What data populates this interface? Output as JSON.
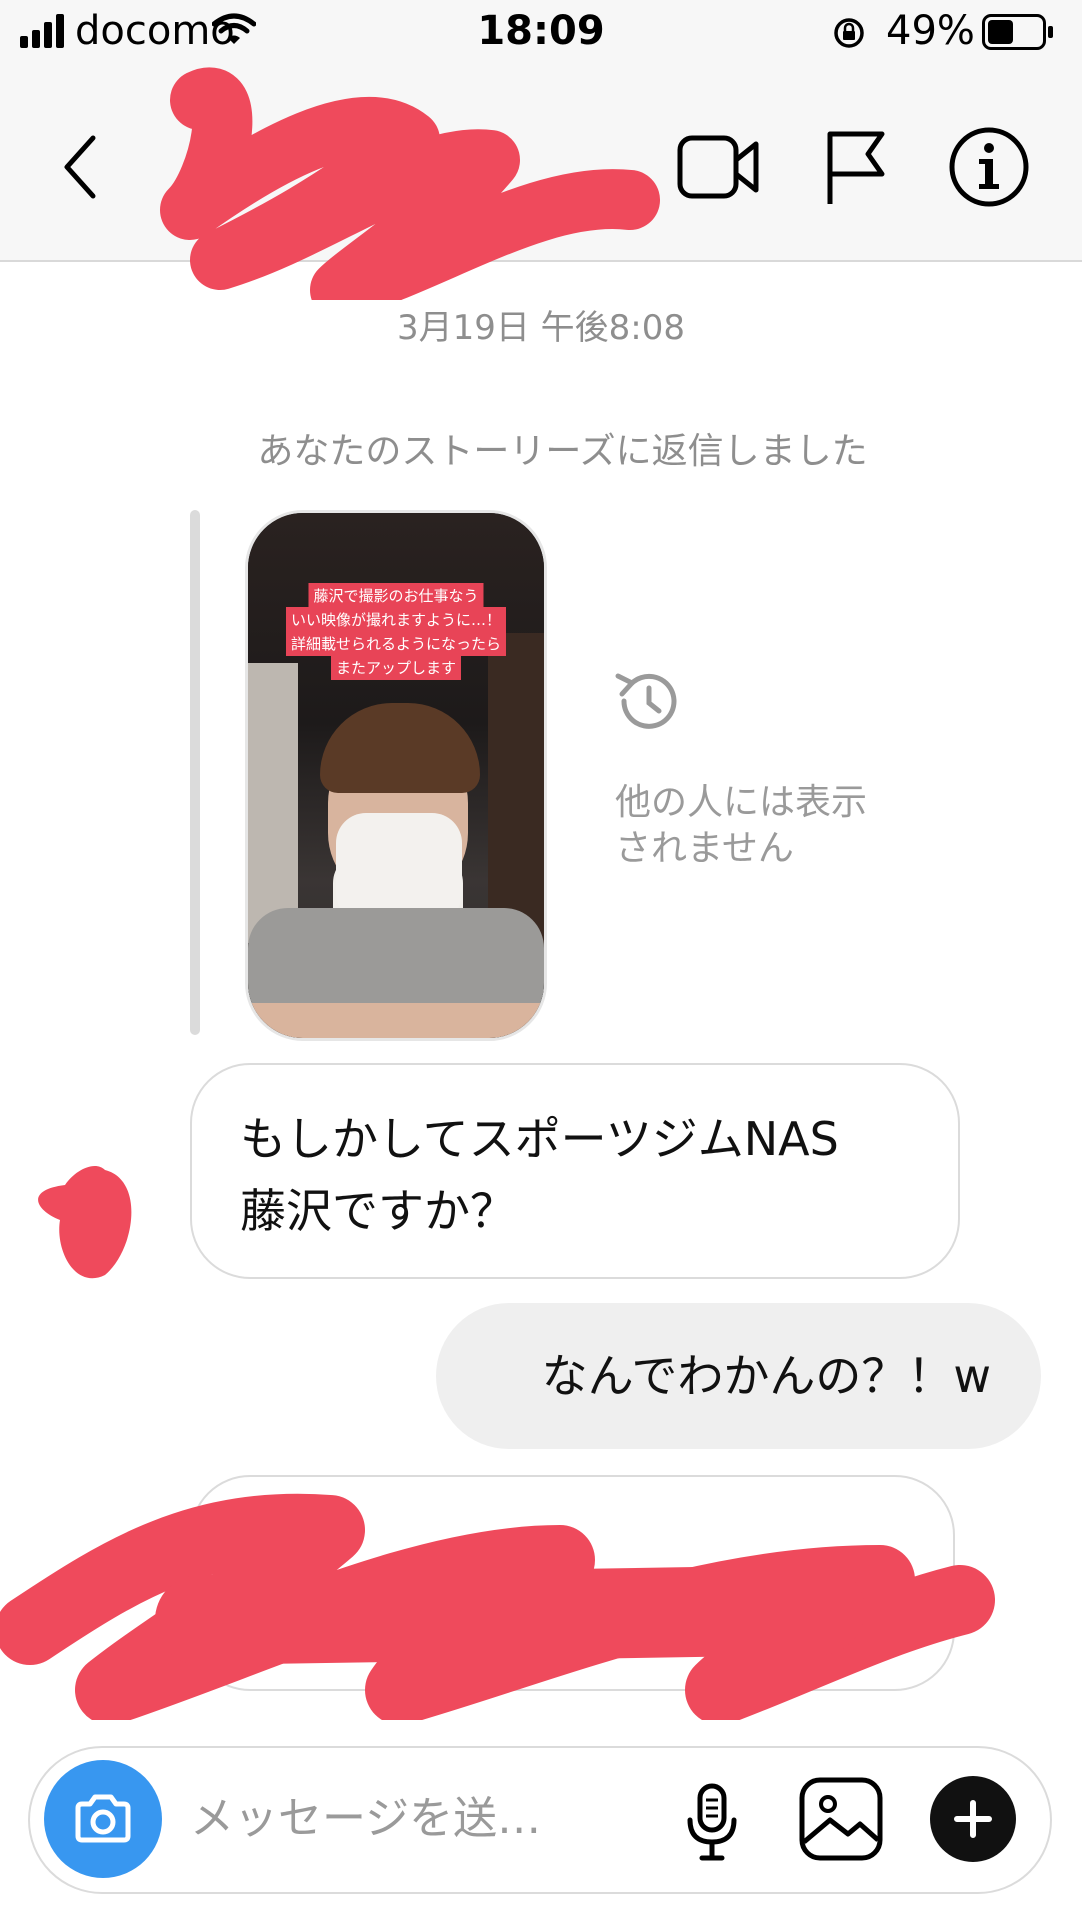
{
  "status_bar": {
    "carrier": "docomo",
    "time": "18:09",
    "battery_percent": "49%",
    "battery_level": 0.49
  },
  "thread": {
    "timestamp": "3月19日 午後8:08",
    "story_reply_note": "あなたのストーリーズに返信しました",
    "story_caption_lines": [
      "藤沢で撮影のお仕事なう",
      "いい映像が撮れますように…！",
      "詳細載せられるようになったら",
      "またアップします"
    ],
    "story_expired_text_line1": "他の人には表示",
    "story_expired_text_line2": "されません",
    "messages": [
      {
        "direction": "incoming",
        "line1": "もしかしてスポーツジムNAS",
        "line2": "藤沢ですか？"
      },
      {
        "direction": "outgoing",
        "text": "なんでわかんの？！w"
      }
    ]
  },
  "composer": {
    "placeholder": "メッセージを送…"
  },
  "colors": {
    "accent_blue": "#3897f0",
    "redaction": "#ef4a5c",
    "outgoing_bubble": "#efefef",
    "header_bg": "#f7f7f7"
  },
  "icons": [
    "signal-icon",
    "wifi-icon",
    "rotation-lock-icon",
    "battery-icon",
    "back-chevron-icon",
    "video-call-icon",
    "flag-icon",
    "info-icon",
    "history-icon",
    "camera-icon",
    "microphone-icon",
    "gallery-icon",
    "plus-icon"
  ]
}
